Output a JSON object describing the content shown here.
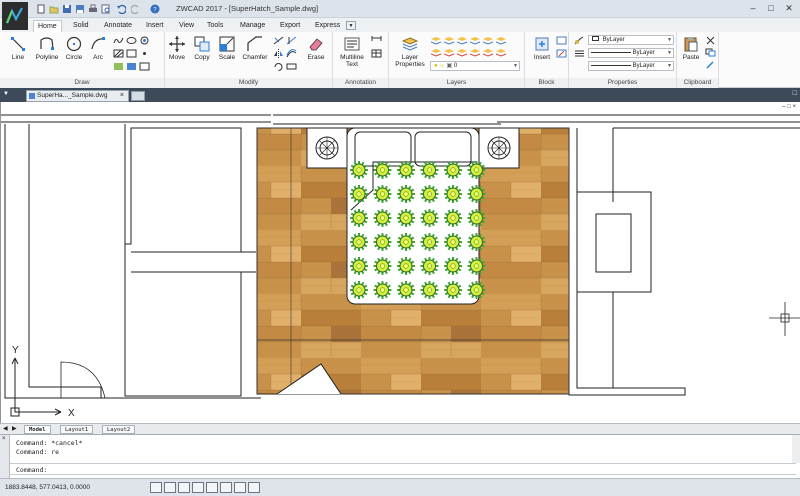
{
  "window": {
    "title": "ZWCAD 2017 - [SuperHatch_Sample.dwg]",
    "title_icon": "zwcad-logo",
    "controls": [
      "minimize",
      "maximize",
      "close"
    ]
  },
  "quick_access": [
    "new-icon",
    "open-icon",
    "save-icon",
    "saveas-icon",
    "print-icon",
    "print-preview-icon",
    "undo-icon",
    "redo-icon",
    "help-icon"
  ],
  "ribbon_tabs": [
    "Home",
    "Solid",
    "Annotate",
    "Insert",
    "View",
    "Tools",
    "Manage",
    "Export",
    "Express"
  ],
  "active_tab": "Home",
  "panels": {
    "draw": {
      "title": "Draw",
      "tools": [
        "Line",
        "Polyline",
        "Circle",
        "Arc"
      ]
    },
    "modify": {
      "title": "Modify",
      "tools": [
        "Move",
        "Copy",
        "Scale",
        "Chamfer",
        "Erase"
      ]
    },
    "annotation": {
      "title": "Annotation",
      "tools": [
        "Multiline\nText"
      ],
      "multiline": "Multiline",
      "text": "Text"
    },
    "layers": {
      "title": "Layers",
      "layer_properties_1": "Layer",
      "layer_properties_2": "Properties",
      "current_layer": "0"
    },
    "block": {
      "title": "Block",
      "insert": "Insert"
    },
    "properties": {
      "title": "Properties",
      "color": "ByLayer",
      "linetype": "ByLayer",
      "lineweight": "ByLayer"
    },
    "clipboard": {
      "title": "Clipboard",
      "paste": "Paste"
    }
  },
  "document_tab": {
    "label": "SuperHa..._Sample.dwg",
    "close": "×"
  },
  "layout_tabs": [
    "Model",
    "Layout1",
    "Layout2"
  ],
  "active_layout": "Model",
  "command_history": [
    "Command: *cancel*",
    "Command: re"
  ],
  "command_prompt": "Command:",
  "status": {
    "coordinates": "1883.8448,  577.0413,  0.0000"
  },
  "ucs": {
    "x_label": "X",
    "y_label": "Y"
  },
  "colors": {
    "wood": "#c8924a",
    "flower_center": "#d8ee3c",
    "flower_petal": "#3fa63a",
    "title_bg": "#dde3ea",
    "doctab_bar": "#3c4a5a"
  }
}
